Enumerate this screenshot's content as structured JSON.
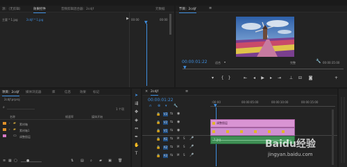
{
  "source_panel": {
    "tabs": [
      "源：（无剪辑）",
      "效果控件",
      "音频剪辑混合器：2cdjf",
      "元数据"
    ],
    "active_tab": 1,
    "row_label": "主要 * 1.jpg",
    "row_value": "2cdjf * 1.jpg",
    "mini_time_start": "00:00",
    "mini_time_end": "00:00"
  },
  "program_monitor": {
    "title": "节目：2cdjf",
    "timecode": "00:00:01:22",
    "fit_label": "适合",
    "quality_label": "完整",
    "duration": "00:00:35:00"
  },
  "project_panel": {
    "tabs": [
      "项目：2cdjf",
      "媒体浏览器",
      "库",
      "信息",
      "效果",
      "标记"
    ],
    "active_tab": 0,
    "project_file": "2cdjf.prproj",
    "count_label": "1 个项",
    "columns": [
      "名称",
      "帧速率",
      "媒体开始"
    ],
    "items": [
      {
        "name": "素材箱",
        "color": "#e0912a"
      },
      {
        "name": "素材箱1",
        "color": "#e0912a"
      },
      {
        "name": "调整图层",
        "color": "#d77ac8"
      }
    ]
  },
  "timeline": {
    "title": "2cdjf",
    "timecode": "00:00:01:22",
    "ruler_labels": [
      ":00:00",
      "00:00:05:00",
      "00:00:10:00",
      "00:00:15:00"
    ],
    "video_tracks": [
      "V3",
      "V2",
      "V1"
    ],
    "audio_tracks": [
      "A1",
      "A2",
      "A3"
    ],
    "adjustment_clip": "调整图层",
    "image_clip": "1.jpg"
  },
  "watermark": {
    "brand": "Baidu经验",
    "url": "jingyan.baidu.com"
  }
}
